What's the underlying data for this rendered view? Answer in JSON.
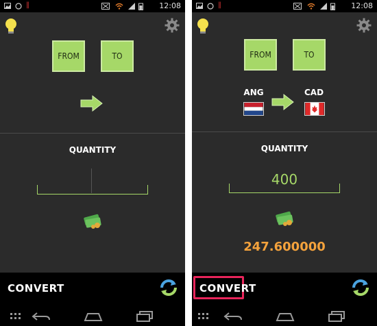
{
  "status": {
    "time": "12:08"
  },
  "buttons": {
    "from": "FROM",
    "to": "TO"
  },
  "left": {
    "quantity_label": "QUANTITY",
    "convert_label": "CONVERT"
  },
  "right": {
    "from_currency": "ANG",
    "to_currency": "CAD",
    "quantity_label": "QUANTITY",
    "quantity_value": "400",
    "result": "247.600000",
    "convert_label": "CONVERT"
  },
  "colors": {
    "accent_green": "#a6d868",
    "result_orange": "#f4a23c",
    "highlight_pink": "#e8245a",
    "background": "#2b2b2b"
  },
  "icons": [
    "lightbulb-icon",
    "settings-gear-icon",
    "arrow-right-icon",
    "money-icon",
    "refresh-icon",
    "apps-grid-icon",
    "back-icon",
    "home-icon",
    "recents-icon"
  ]
}
